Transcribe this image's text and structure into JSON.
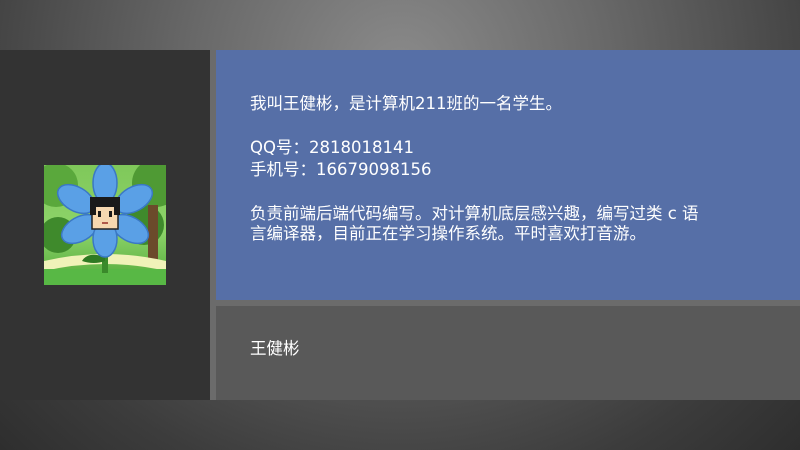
{
  "profile": {
    "intro": "我叫王健彬，是计算机211班的一名学生。",
    "qq": "QQ号：2818018141",
    "phone": "手机号：16679098156",
    "bio": "负责前端后端代码编写。对计算机底层感兴趣，编写过类 c 语言编译器，目前正在学习操作系统。平时喜欢打音游。",
    "name": "王健彬"
  },
  "colors": {
    "info_panel": "#566fa7",
    "name_panel": "#595959",
    "left_panel": "#333333",
    "divider": "#6b6b6b"
  },
  "avatar": {
    "icon": "blue-flower-character-icon"
  }
}
